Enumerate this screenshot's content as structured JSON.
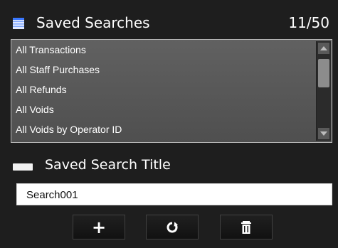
{
  "header": {
    "title": "Saved Searches",
    "count": "11/50",
    "icon": "list-icon"
  },
  "list": {
    "items": [
      "All Transactions",
      "All Staff Purchases",
      "All Refunds",
      "All Voids",
      "All Voids by Operator ID"
    ]
  },
  "section": {
    "icon": "keyboard-icon",
    "label": "Saved Search Title"
  },
  "input": {
    "value": "Search001"
  },
  "buttons": {
    "add": "+",
    "refresh_icon": "refresh-icon",
    "delete_icon": "trash-icon"
  },
  "colors": {
    "panel": "#1e1e1e",
    "list_bg": "#5a5a5a",
    "text": "#ffffff"
  }
}
